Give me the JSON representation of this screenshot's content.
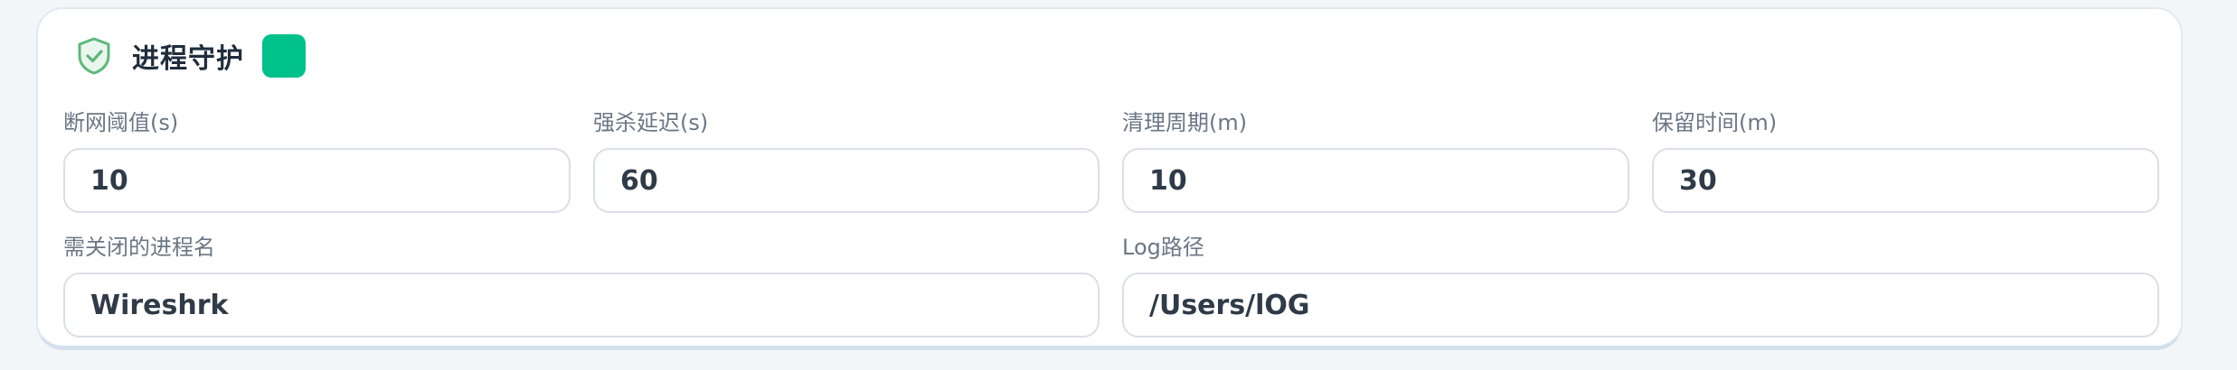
{
  "panel": {
    "title": "进程守护",
    "status_color": "#00c18c",
    "shield_icon": "shield-check-icon"
  },
  "fields": {
    "disconnect_threshold": {
      "label": "断网阈值(s)",
      "value": "10"
    },
    "force_kill_delay": {
      "label": "强杀延迟(s)",
      "value": "60"
    },
    "cleanup_period": {
      "label": "清理周期(m)",
      "value": "10"
    },
    "retention_time": {
      "label": "保留时间(m)",
      "value": "30"
    },
    "process_names": {
      "label": "需关闭的进程名",
      "value": "Wireshrk"
    },
    "log_path": {
      "label": "Log路径",
      "value": "/Users/lOG"
    }
  }
}
